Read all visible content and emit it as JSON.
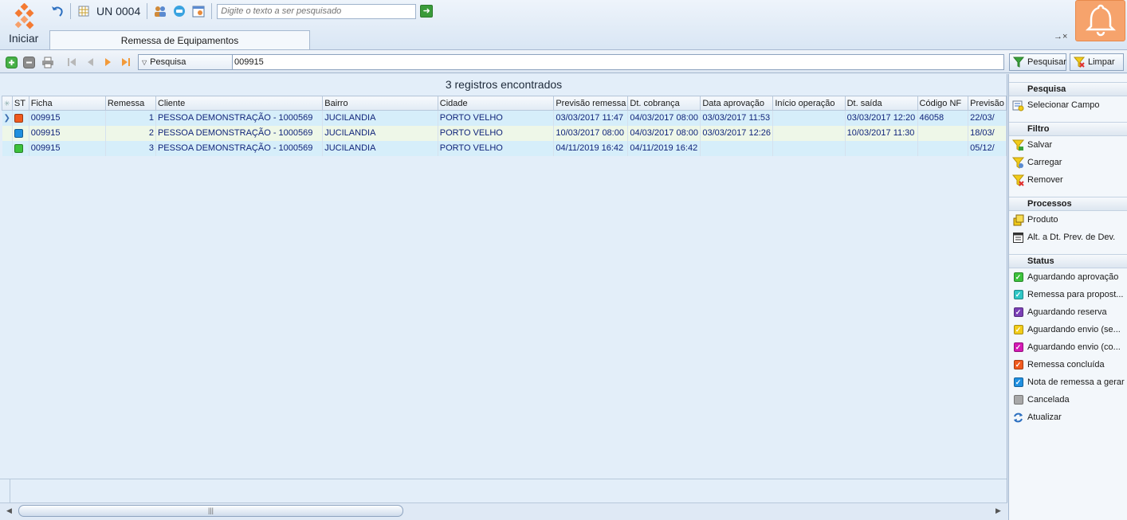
{
  "app": {
    "start_label": "Iniciar",
    "unit_label": "UN 0004",
    "top_search_placeholder": "Digite o texto a ser pesquisado",
    "tab_title": "Remessa de Equipamentos",
    "tab_controls": "→×"
  },
  "searchbar": {
    "field_label": "Pesquisa",
    "query": "009915",
    "search_button": "Pesquisar",
    "clear_button": "Limpar"
  },
  "grid": {
    "count_title": "3 registros encontrados",
    "columns": [
      "ST",
      "Ficha",
      "Remessa",
      "Cliente",
      "Bairro",
      "Cidade",
      "Previsão remessa",
      "Dt. cobrança",
      "Data aprovação",
      "Início operação",
      "Dt. saída",
      "Código NF",
      "Previsão"
    ],
    "rows": [
      {
        "status_color": "#f05a1e",
        "ficha": "009915",
        "remessa": "1",
        "cliente": "PESSOA DEMONSTRAÇÃO -  1000569",
        "bairro": "JUCILANDIA",
        "cidade": "PORTO VELHO",
        "previsao_remessa": "03/03/2017 11:47",
        "dt_cobranca": "04/03/2017 08:00",
        "data_aprovacao": "03/03/2017 11:53",
        "inicio_operacao": "",
        "dt_saida": "03/03/2017 12:20",
        "codigo_nf": "46058",
        "previsao": "22/03/"
      },
      {
        "status_color": "#1f8fe0",
        "ficha": "009915",
        "remessa": "2",
        "cliente": "PESSOA DEMONSTRAÇÃO -  1000569",
        "bairro": "JUCILANDIA",
        "cidade": "PORTO VELHO",
        "previsao_remessa": "10/03/2017 08:00",
        "dt_cobranca": "04/03/2017 08:00",
        "data_aprovacao": "03/03/2017 12:26",
        "inicio_operacao": "",
        "dt_saida": "10/03/2017 11:30",
        "codigo_nf": "",
        "previsao": "18/03/"
      },
      {
        "status_color": "#3cc23c",
        "ficha": "009915",
        "remessa": "3",
        "cliente": "PESSOA DEMONSTRAÇÃO -  1000569",
        "bairro": "JUCILANDIA",
        "cidade": "PORTO VELHO",
        "previsao_remessa": "04/11/2019 16:42",
        "dt_cobranca": "04/11/2019 16:42",
        "data_aprovacao": "",
        "inicio_operacao": "",
        "dt_saida": "",
        "codigo_nf": "",
        "previsao": "05/12/"
      }
    ],
    "scroll_thumb_glyph": "|||"
  },
  "panel": {
    "sections": {
      "pesquisa": "Pesquisa",
      "filtro": "Filtro",
      "processos": "Processos",
      "status": "Status"
    },
    "pesquisa_items": [
      "Selecionar Campo"
    ],
    "filtro_items": [
      "Salvar",
      "Carregar",
      "Remover"
    ],
    "processos_items": [
      "Produto",
      "Alt. a Dt. Prev. de Dev."
    ],
    "status_items": [
      {
        "label": "Aguardando aprovação",
        "color": "#3cc23c"
      },
      {
        "label": "Remessa para propost...",
        "color": "#2fc6c6"
      },
      {
        "label": "Aguardando reserva",
        "color": "#7a3fb5"
      },
      {
        "label": "Aguardando envio (se...",
        "color": "#f2cc1a"
      },
      {
        "label": "Aguardando envio (co...",
        "color": "#d419b4"
      },
      {
        "label": "Remessa concluída",
        "color": "#f05a1e"
      },
      {
        "label": "Nota de remessa a gerar",
        "color": "#1f8fe0"
      },
      {
        "label": "Cancelada",
        "color": "#a8a8a8"
      }
    ],
    "refresh_label": "Atualizar"
  }
}
